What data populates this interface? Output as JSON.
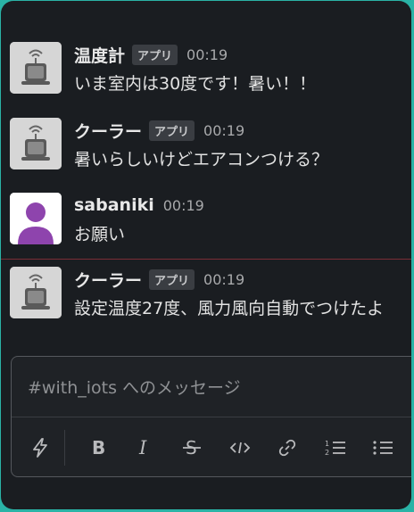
{
  "messages": [
    {
      "name": "温度計",
      "badge": "アプリ",
      "time": "00:19",
      "text": "いま室内は30度です！暑い！！"
    },
    {
      "name": "クーラー",
      "badge": "アプリ",
      "time": "00:19",
      "text": "暑いらしいけどエアコンつける？"
    },
    {
      "name": "sabaniki",
      "time": "00:19",
      "text": "お願い"
    },
    {
      "name": "クーラー",
      "badge": "アプリ",
      "time": "00:19",
      "text": "設定温度27度、風力風向自動でつけたよ"
    }
  ],
  "composer": {
    "placeholder": "#with_iots へのメッセージ"
  },
  "toolbar": {
    "icons": [
      "shortcuts-lightning-icon",
      "bold-icon",
      "italic-icon",
      "strikethrough-icon",
      "code-icon",
      "link-icon",
      "ordered-list-icon",
      "bulleted-list-icon"
    ]
  },
  "colors": {
    "background": "#1a1d21",
    "outer_border": "#2ab3a6",
    "user_avatar": "#8e44ad",
    "new_messages_divider": "#7a2d36"
  }
}
